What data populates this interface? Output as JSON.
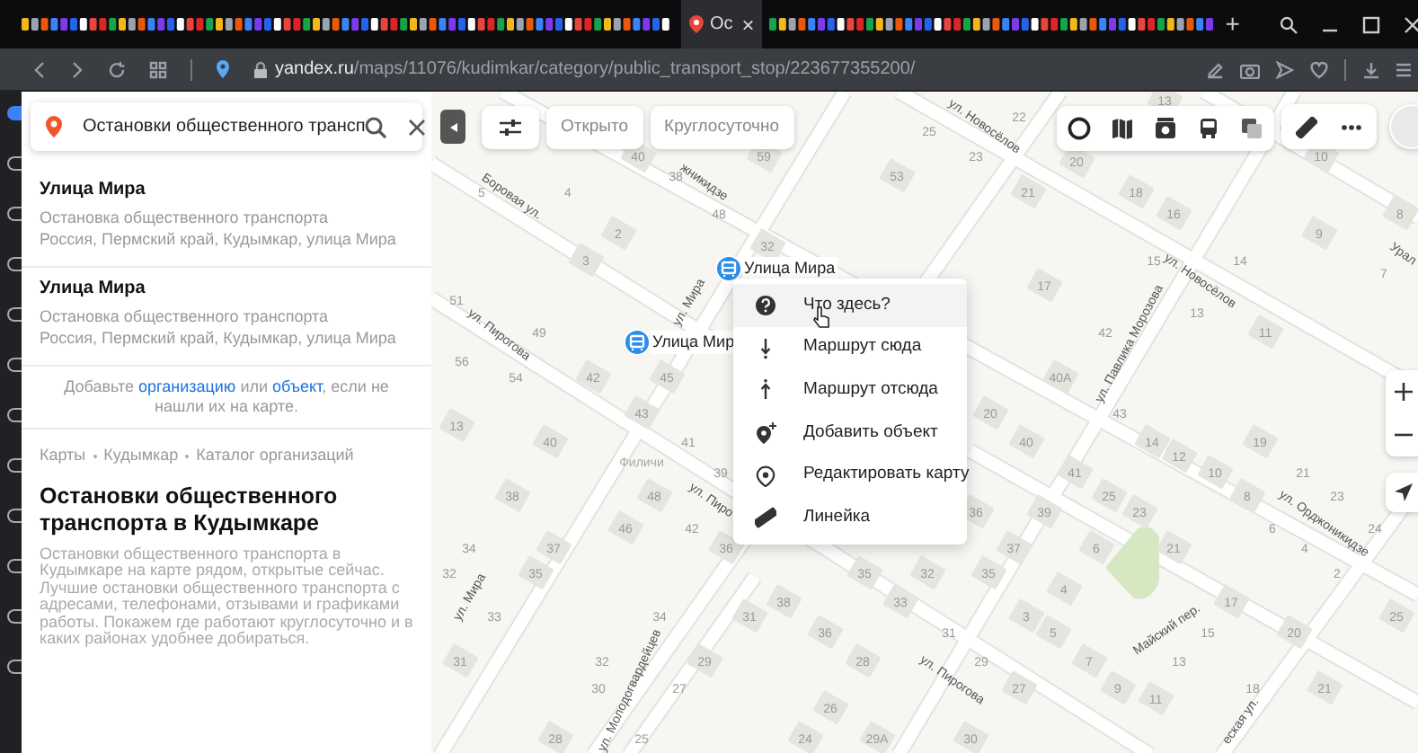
{
  "browser": {
    "active_tab": {
      "title": "Ос",
      "close": "×"
    },
    "new_tab": "+",
    "url": {
      "host": "yandex.ru",
      "path": "/maps/11076/kudimkar/category/public_transport_stop/223677355200/"
    }
  },
  "search": {
    "value": "Остановки общественного трансп"
  },
  "results": [
    {
      "title": "Улица Мира",
      "category": "Остановка общественного транспорта",
      "address": "Россия, Пермский край, Кудымкар, улица Мира"
    },
    {
      "title": "Улица Мира",
      "category": "Остановка общественного транспорта",
      "address": "Россия, Пермский край, Кудымкар, улица Мира"
    }
  ],
  "add_hint": {
    "before": "Добавьте ",
    "link_1": "организацию",
    "middle": " или ",
    "link_2": "объект",
    "after": ", если не нашли их на карте."
  },
  "breadcrumbs": [
    "Карты",
    "Кудымкар",
    "Каталог организаций"
  ],
  "heading": "Остановки общественного транспорта в Кудымкаре",
  "description": "Остановки общественного транспорта в Кудымкаре на карте рядом, открытые сейчас. Лучшие остановки общественного транспорта с адресами, телефонами, отзывами и графиками работы. Покажем где работают круглосуточно и в каких районах удобнее добираться.",
  "filters": [
    {
      "label": "Открыто"
    },
    {
      "label": "Круглосуточно"
    }
  ],
  "stops": [
    {
      "label": "Улица Мира"
    },
    {
      "label": "Улица Мир"
    }
  ],
  "context_menu": [
    {
      "kind": "question",
      "label": "Что здесь?",
      "hovered": true
    },
    {
      "kind": "route_to",
      "label": "Маршрут сюда",
      "hovered": false
    },
    {
      "kind": "route_from",
      "label": "Маршрут отсюда",
      "hovered": false
    },
    {
      "kind": "add",
      "label": "Добавить объект",
      "hovered": false
    },
    {
      "kind": "edit",
      "label": "Редактировать карту",
      "hovered": false
    },
    {
      "kind": "ruler",
      "label": "Линейка",
      "hovered": false
    }
  ],
  "map_labels": {
    "streets": [
      "Боровая ул.",
      "жникидзе",
      "ул. Новосёлов",
      "ул. Новосёлов",
      "Урал",
      "ул. Пирогова",
      "ул. Мира",
      "ул. Мира",
      "Филичи",
      "ул. Пиро",
      "ул. Павлика Морозова",
      "ул. Орджоникидзе",
      "Майский пер.",
      "ул. Молодогвардейцев",
      "ул. Пирогова",
      "еская ул."
    ],
    "houses": [
      "13",
      "22",
      "25",
      "40",
      "59",
      "23",
      "20",
      "10",
      "38",
      "53",
      "5",
      "4",
      "21",
      "18",
      "48",
      "16",
      "8",
      "2",
      "9",
      "32",
      "3",
      "15",
      "14",
      "7",
      "17",
      "51",
      "13",
      "49",
      "42",
      "11",
      "56",
      "54",
      "42",
      "45",
      "40А",
      "43",
      "20",
      "43",
      "13",
      "40",
      "41",
      "40",
      "14",
      "19",
      "12",
      "39",
      "41",
      "10",
      "21",
      "38",
      "48",
      "25",
      "8",
      "23",
      "36",
      "39",
      "23",
      "46",
      "42",
      "6",
      "24",
      "34",
      "37",
      "36",
      "37",
      "6",
      "21",
      "4",
      "32",
      "35",
      "35",
      "32",
      "35",
      "2",
      "4",
      "38",
      "33",
      "17",
      "33",
      "34",
      "31",
      "3",
      "25",
      "36",
      "31",
      "5",
      "15",
      "20",
      "31",
      "32",
      "29",
      "28",
      "29",
      "7",
      "13",
      "30",
      "27",
      "27",
      "9",
      "11",
      "18",
      "21",
      "26",
      "28",
      "25",
      "24",
      "29А",
      "30"
    ]
  }
}
